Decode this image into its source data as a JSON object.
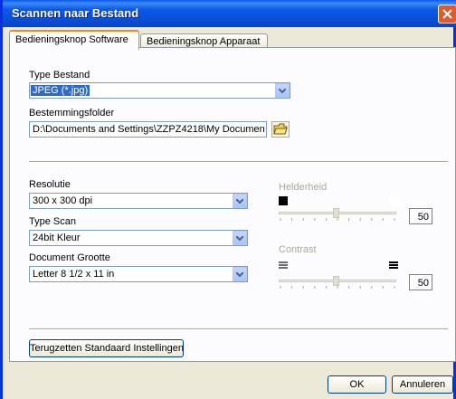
{
  "window": {
    "title": "Scannen naar Bestand"
  },
  "tabs": [
    {
      "label": "Bedieningsknop Software",
      "active": true
    },
    {
      "label": "Bedieningsknop Apparaat",
      "active": false
    }
  ],
  "file_type": {
    "label": "Type Bestand",
    "value": "JPEG (*.jpg)"
  },
  "destination": {
    "label": "Bestemmingsfolder",
    "value": "D:\\Documents and Settings\\ZZPZ4218\\My Documen"
  },
  "resolution": {
    "label": "Resolutie",
    "value": "300 x 300 dpi"
  },
  "scan_type": {
    "label": "Type Scan",
    "value": "24bit Kleur"
  },
  "doc_size": {
    "label": "Document Grootte",
    "value": "Letter 8 1/2 x 11 in"
  },
  "brightness": {
    "label": "Helderheid",
    "value": "50",
    "level": 0.5
  },
  "contrast": {
    "label": "Contrast",
    "value": "50",
    "level": 0.5
  },
  "reset_button": {
    "label": "Terugzetten Standaard Instellingen"
  },
  "buttons": {
    "ok": "OK",
    "cancel": "Annuleren"
  },
  "colors": {
    "title_bar": "#0a4fd9",
    "selection": "#316ac5",
    "dialog_bg": "#ece9d8"
  }
}
